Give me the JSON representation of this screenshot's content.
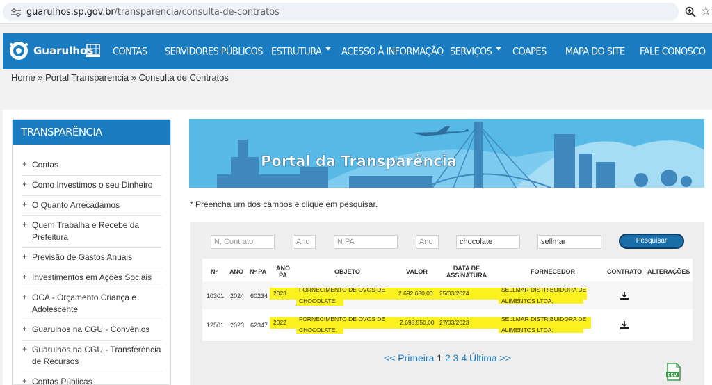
{
  "browser": {
    "url_host": "guarulhos.sp.gov.br",
    "url_path": "/transparencia/consulta-de-contratos"
  },
  "nav": {
    "logo_text": "Guarulhos",
    "items": [
      {
        "label": "CONTAS"
      },
      {
        "label": "SERVIDORES PÚBLICOS"
      },
      {
        "label": "ESTRUTURA"
      },
      {
        "label": "ACESSO À INFORMAÇÃO"
      },
      {
        "label": "SERVIÇOS"
      },
      {
        "label": "COAPES"
      },
      {
        "label": "MAPA DO SITE"
      },
      {
        "label": "FALE CONOSCO"
      }
    ]
  },
  "breadcrumb": "Home » Portal Transparencia » Consulta de Contratos",
  "sidebar": {
    "title": "TRANSPARÊNCIA",
    "items": [
      {
        "label": "Contas"
      },
      {
        "label": "Como Investimos o seu Dinheiro"
      },
      {
        "label": "O Quanto Arrecadamos"
      },
      {
        "label": "Quem Trabalha e Recebe da Prefeitura"
      },
      {
        "label": "Previsão de Gastos Anuais"
      },
      {
        "label": "Investimentos em Ações Sociais"
      },
      {
        "label": "OCA - Orçamento Criança e Adolescente"
      },
      {
        "label": "Guarulhos na CGU - Convênios"
      },
      {
        "label": "Guarulhos na CGU - Transferência de Recursos"
      },
      {
        "label": "Contas Públicas"
      }
    ]
  },
  "banner": {
    "title": "Portal da Transparência"
  },
  "hint": "* Preencha um dos campos e clique em pesquisar.",
  "search": {
    "n_contrato_placeholder": "N. Contrato",
    "ano_placeholder": "Ano",
    "n_pa_placeholder": "N PA",
    "ano_pa_placeholder": "Ano",
    "objeto_value": "chocolate",
    "fornecedor_value": "sellmar",
    "button": "Pesquisar"
  },
  "table": {
    "headers": {
      "n": "Nº",
      "ano": "ANO",
      "npa": "Nº PA",
      "anopa_1": "ANO",
      "anopa_2": "PA",
      "objeto": "OBJETO",
      "valor": "VALOR",
      "data_1": "DATA DE",
      "data_2": "ASSINATURA",
      "fornecedor": "FORNECEDOR",
      "contrato": "CONTRATO",
      "alteracoes": "ALTERAÇÕES"
    },
    "rows": [
      {
        "n": "10301",
        "ano": "2024",
        "npa": "60234",
        "anopa": "2023",
        "objeto_1": "FORNECIMENTO DE OVOS DE",
        "objeto_2": "CHOCOLATE",
        "valor": "2.692.680,00",
        "data": "25/03/2024",
        "fornecedor_1": "SELLMAR DISTRIBUIDORA DE",
        "fornecedor_2": "ALIMENTOS LTDA."
      },
      {
        "n": "12501",
        "ano": "2023",
        "npa": "62347",
        "anopa": "2022",
        "objeto_1": "FORNECIMENTO DE OVOS DE",
        "objeto_2": "CHOCOLATE.",
        "valor": "2.698.550,00",
        "data": "27/03/2023",
        "fornecedor_1": "SELLMAR DISTRIBUIDORA DE",
        "fornecedor_2": "ALIMENTOS LTDA."
      }
    ]
  },
  "pager": {
    "first": "<< Primeira",
    "current": "1",
    "pages": [
      "2",
      "3",
      "4"
    ],
    "last": "Última >>"
  },
  "icons": {
    "site_settings": "tune-icon",
    "zoom": "zoom-icon",
    "bookmark": "star-icon",
    "download": "download-icon",
    "export": "csv-icon"
  },
  "colors": {
    "brand_blue": "#1a7cc0",
    "highlight": "#fbf11f",
    "banner": "#56b9e6"
  }
}
